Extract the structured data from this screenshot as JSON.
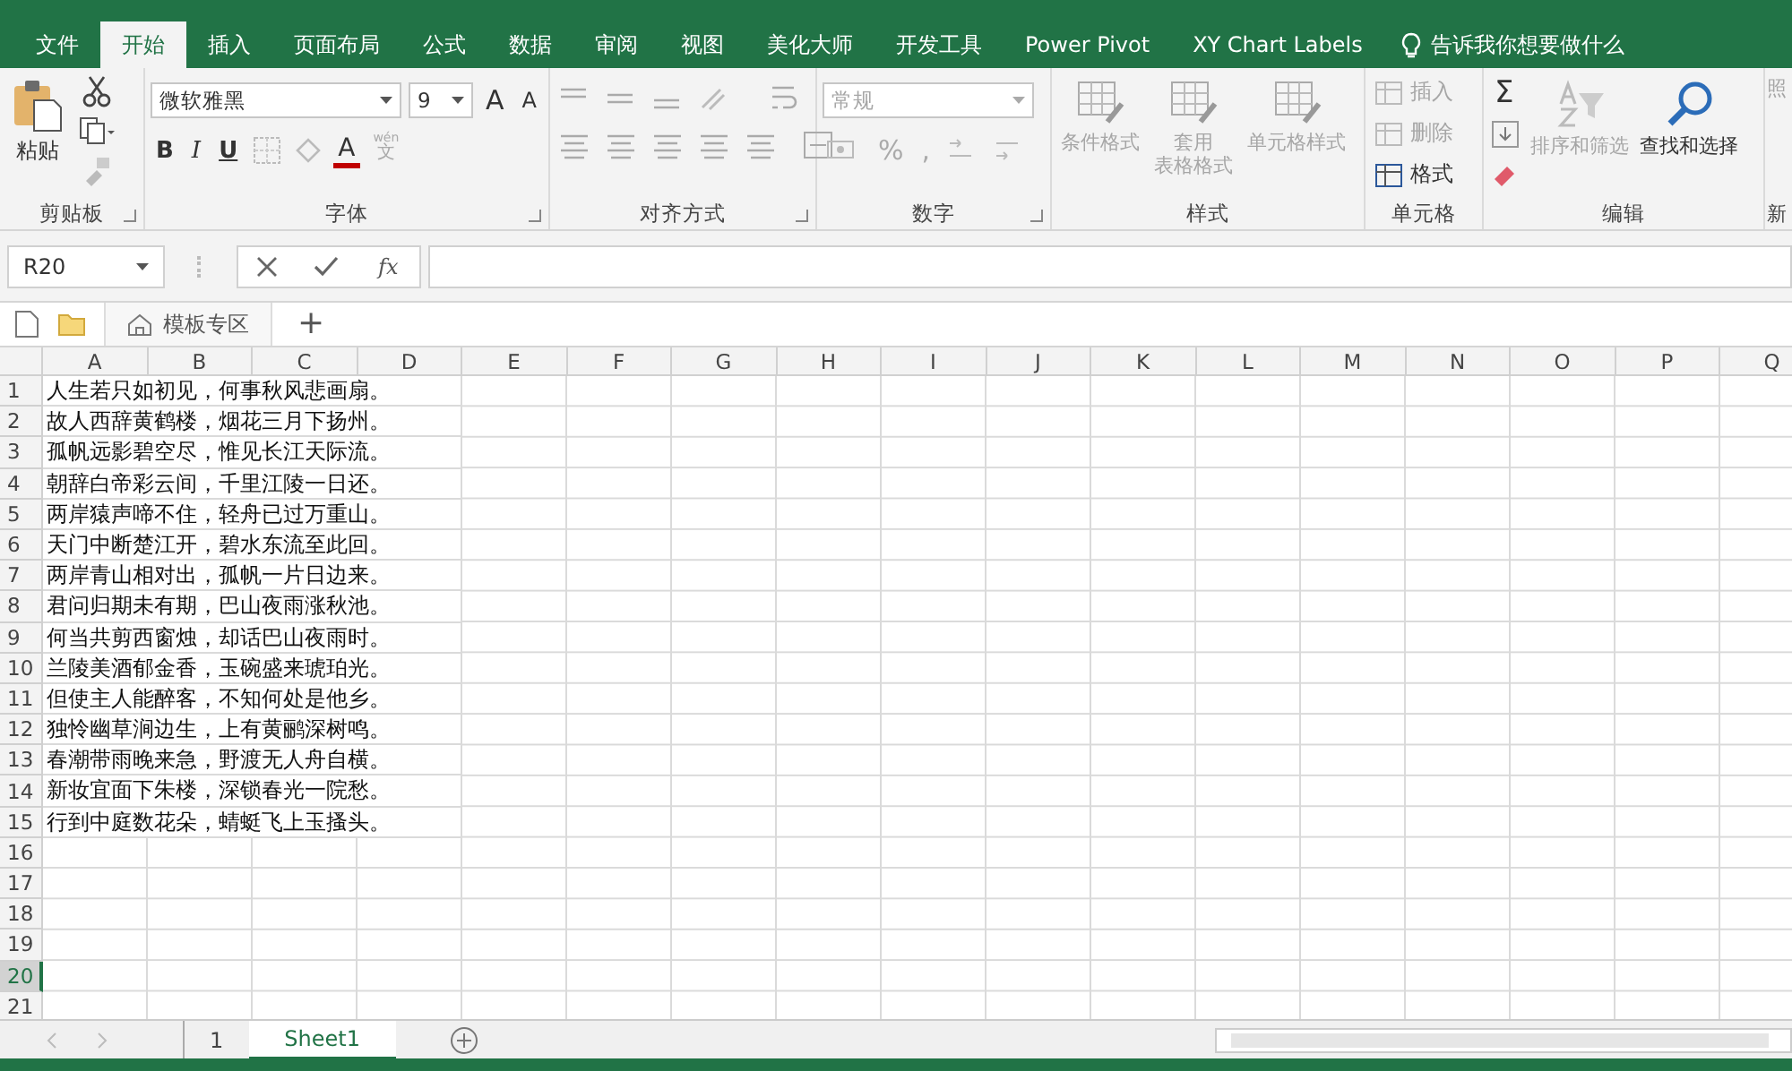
{
  "tabs": [
    {
      "label": "文件",
      "selected": false
    },
    {
      "label": "开始",
      "selected": true
    },
    {
      "label": "插入",
      "selected": false
    },
    {
      "label": "页面布局",
      "selected": false
    },
    {
      "label": "公式",
      "selected": false
    },
    {
      "label": "数据",
      "selected": false
    },
    {
      "label": "审阅",
      "selected": false
    },
    {
      "label": "视图",
      "selected": false
    },
    {
      "label": "美化大师",
      "selected": false
    },
    {
      "label": "开发工具",
      "selected": false
    },
    {
      "label": "Power Pivot",
      "selected": false
    },
    {
      "label": "XY Chart Labels",
      "selected": false
    }
  ],
  "tell_me": {
    "placeholder": "告诉我你想要做什么"
  },
  "ribbon": {
    "clipboard": {
      "paste": "粘贴",
      "label": "剪贴板"
    },
    "font": {
      "name": "微软雅黑",
      "size": "9",
      "grow": "A",
      "shrink": "A",
      "bold": "B",
      "italic": "I",
      "underline": "U",
      "color_letter": "A",
      "phonetic_top": "wén",
      "phonetic_bottom": "文",
      "label": "字体"
    },
    "alignment": {
      "label": "对齐方式"
    },
    "number": {
      "format": "常规",
      "percent": "%",
      "comma": ",",
      "label": "数字"
    },
    "styles": {
      "buttons": [
        {
          "lines": [
            "条件格式"
          ],
          "disabled": true
        },
        {
          "lines": [
            "套用",
            "表格格式"
          ],
          "disabled": true
        },
        {
          "lines": [
            "单元格样式"
          ],
          "disabled": true
        }
      ],
      "label": "样式"
    },
    "cells": {
      "buttons": [
        {
          "label": "插入",
          "disabled": true
        },
        {
          "label": "删除",
          "disabled": true
        },
        {
          "label": "格式",
          "disabled": false
        }
      ],
      "label": "单元格"
    },
    "editing": {
      "autosum": "Σ",
      "sort": {
        "label": "排序和筛选",
        "disabled": true
      },
      "find": {
        "label": "查找和选择",
        "disabled": false
      },
      "label": "编辑"
    },
    "next_group": {
      "button": "照",
      "label": "新"
    }
  },
  "formula_bar": {
    "name_box": "R20",
    "fx": "fx"
  },
  "template_bar": {
    "tab": "模板专区",
    "add": "+"
  },
  "sheet": {
    "columns": [
      "A",
      "B",
      "C",
      "D",
      "E",
      "F",
      "G",
      "H",
      "I",
      "J",
      "K",
      "L",
      "M",
      "N",
      "O",
      "P",
      "Q"
    ],
    "rows": [
      {
        "number": "1",
        "selected": false,
        "text": "人生若只如初见，何事秋风悲画扇。"
      },
      {
        "number": "2",
        "selected": false,
        "text": "故人西辞黄鹤楼，烟花三月下扬州。"
      },
      {
        "number": "3",
        "selected": false,
        "text": "孤帆远影碧空尽，惟见长江天际流。"
      },
      {
        "number": "4",
        "selected": false,
        "text": "朝辞白帝彩云间，千里江陵一日还。"
      },
      {
        "number": "5",
        "selected": false,
        "text": "两岸猿声啼不住，轻舟已过万重山。"
      },
      {
        "number": "6",
        "selected": false,
        "text": "天门中断楚江开，碧水东流至此回。"
      },
      {
        "number": "7",
        "selected": false,
        "text": "两岸青山相对出，孤帆一片日边来。"
      },
      {
        "number": "8",
        "selected": false,
        "text": "君问归期未有期，巴山夜雨涨秋池。"
      },
      {
        "number": "9",
        "selected": false,
        "text": "何当共剪西窗烛，却话巴山夜雨时。"
      },
      {
        "number": "10",
        "selected": false,
        "text": "兰陵美酒郁金香，玉碗盛来琥珀光。"
      },
      {
        "number": "11",
        "selected": false,
        "text": "但使主人能醉客，不知何处是他乡。"
      },
      {
        "number": "12",
        "selected": false,
        "text": "独怜幽草涧边生，上有黄鹂深树鸣。"
      },
      {
        "number": "13",
        "selected": false,
        "text": "春潮带雨晚来急，野渡无人舟自横。"
      },
      {
        "number": "14",
        "selected": false,
        "text": "新妆宜面下朱楼，深锁春光一院愁。"
      },
      {
        "number": "15",
        "selected": false,
        "text": "行到中庭数花朵，蜻蜓飞上玉搔头。"
      },
      {
        "number": "16",
        "selected": false
      },
      {
        "number": "17",
        "selected": false
      },
      {
        "number": "18",
        "selected": false
      },
      {
        "number": "19",
        "selected": false
      },
      {
        "number": "20",
        "selected": true
      },
      {
        "number": "21",
        "selected": false
      }
    ]
  },
  "sheet_tabs": [
    {
      "label": "1",
      "selected": false
    },
    {
      "label": "Sheet1",
      "selected": true
    }
  ]
}
